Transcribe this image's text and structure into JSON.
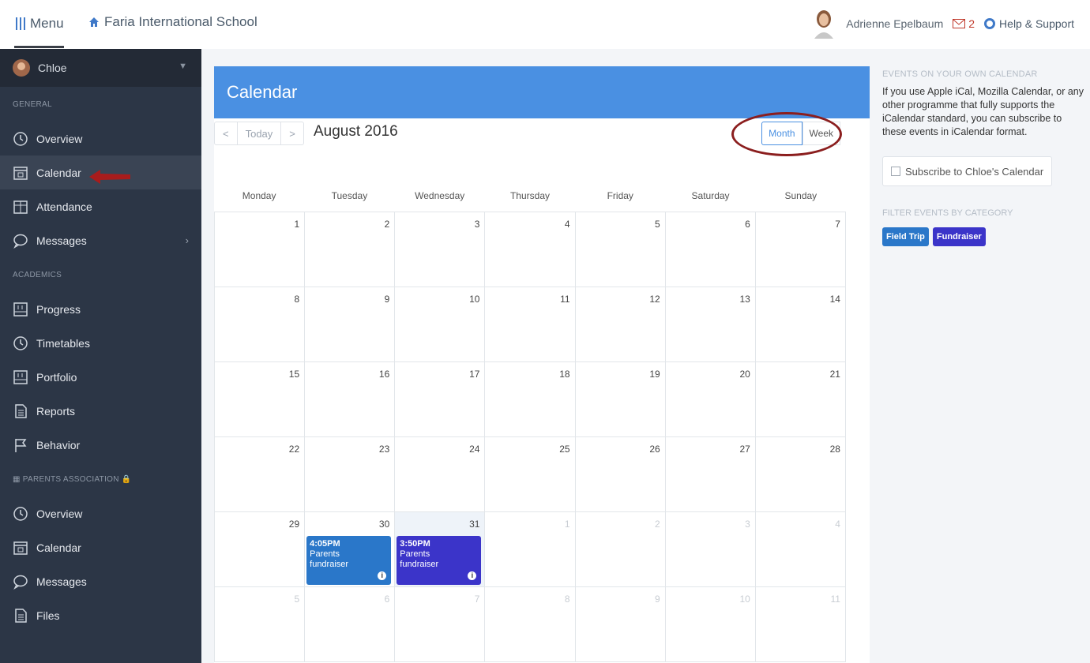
{
  "topbar": {
    "menu_label": "Menu",
    "school_name": "Faria International School",
    "user_name": "Adrienne Epelbaum",
    "mail_count": "2",
    "help_label": "Help & Support"
  },
  "sidebar": {
    "user": "Chloe",
    "sections": {
      "general": "GENERAL",
      "academics": "ACADEMICS",
      "parents": "PARENTS ASSOCIATION"
    },
    "general_items": [
      {
        "label": "Overview",
        "icon": "clock-icon"
      },
      {
        "label": "Calendar",
        "icon": "calendar-icon"
      },
      {
        "label": "Attendance",
        "icon": "attendance-icon"
      },
      {
        "label": "Messages",
        "icon": "chat-icon"
      }
    ],
    "academic_items": [
      {
        "label": "Progress",
        "icon": "progress-icon"
      },
      {
        "label": "Timetables",
        "icon": "clock-icon"
      },
      {
        "label": "Portfolio",
        "icon": "portfolio-icon"
      },
      {
        "label": "Reports",
        "icon": "document-icon"
      },
      {
        "label": "Behavior",
        "icon": "flag-icon"
      }
    ],
    "parents_items": [
      {
        "label": "Overview",
        "icon": "clock-icon"
      },
      {
        "label": "Calendar",
        "icon": "calendar-icon"
      },
      {
        "label": "Messages",
        "icon": "chat-icon"
      },
      {
        "label": "Files",
        "icon": "document-icon"
      }
    ]
  },
  "calendar": {
    "header": "Calendar",
    "today_label": "Today",
    "prev_label": "<",
    "next_label": ">",
    "month_title": "August 2016",
    "view_month": "Month",
    "view_week": "Week",
    "weekdays": [
      "Monday",
      "Tuesday",
      "Wednesday",
      "Thursday",
      "Friday",
      "Saturday",
      "Sunday"
    ],
    "weeks": [
      [
        "1",
        "2",
        "3",
        "4",
        "5",
        "6",
        "7"
      ],
      [
        "8",
        "9",
        "10",
        "11",
        "12",
        "13",
        "14"
      ],
      [
        "15",
        "16",
        "17",
        "18",
        "19",
        "20",
        "21"
      ],
      [
        "22",
        "23",
        "24",
        "25",
        "26",
        "27",
        "28"
      ],
      [
        "29",
        "30",
        "31",
        "1",
        "2",
        "3",
        "4"
      ],
      [
        "5",
        "6",
        "7",
        "8",
        "9",
        "10",
        "11"
      ]
    ],
    "events": {
      "tue30": {
        "time": "4:05PM",
        "title1": "Parents",
        "title2": "fundraiser",
        "color": "#2a77c9"
      },
      "wed31": {
        "time": "3:50PM",
        "title1": "Parents",
        "title2": "fundraiser",
        "color": "#3b34c9"
      }
    }
  },
  "right_panel": {
    "own_calendar_heading": "EVENTS ON YOUR OWN CALENDAR",
    "own_calendar_text": "If you use Apple iCal, Mozilla Calendar, or any other programme that fully supports the iCalendar standard, you can subscribe to these events in iCalendar format.",
    "subscribe_label": "Subscribe to Chloe's Calendar",
    "filter_heading": "FILTER EVENTS BY CATEGORY",
    "tags": [
      {
        "label": "Field Trip",
        "color": "#2a77c9"
      },
      {
        "label": "Fundraiser",
        "color": "#3b34c9"
      }
    ]
  }
}
